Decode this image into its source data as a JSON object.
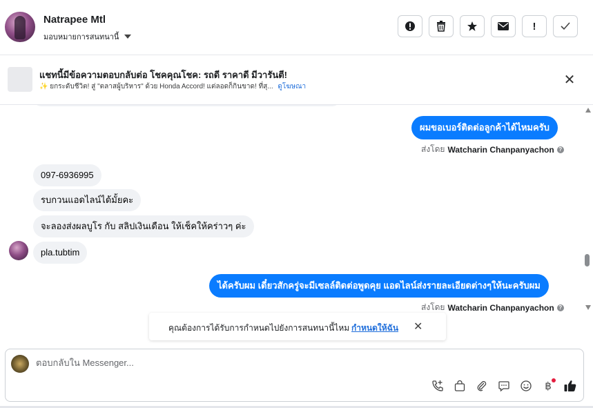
{
  "header": {
    "contact_name": "Natrapee Mtl",
    "assign_label": "มอบหมายการสนทนานี้",
    "actions": [
      {
        "name": "mark-spam-button",
        "icon": "alert-circle-icon"
      },
      {
        "name": "delete-button",
        "icon": "trash-icon"
      },
      {
        "name": "star-button",
        "icon": "star-icon"
      },
      {
        "name": "mark-unread-button",
        "icon": "envelope-icon"
      },
      {
        "name": "flag-button",
        "icon": "exclamation-icon"
      },
      {
        "name": "mark-done-button",
        "icon": "check-icon"
      }
    ]
  },
  "banner": {
    "title": "แชทนี้มีข้อความตอบกลับต่อ โชคคุณโชค: รถดี ราคาดี มีวารันตี!",
    "subtitle": "✨ ยกระดับชีวิต! สู่ \"ตลาสผู้บริหาร\" ด้วย Honda Accord! แต่ลอดก็กินขาด! ที่สุ...",
    "link": "ดูโฆษณา",
    "close_icon": "close-icon"
  },
  "messages": {
    "m1": "ผมขอเบอร์ติดต่อลูกค้าได้ไหมครับ",
    "sent_prefix": "ส่งโดย",
    "sender": "Watcharin Chanpanyachon",
    "m2": "097-6936995",
    "m3": "รบกวนแอดไลน์ได้มั้ยคะ",
    "m4": "จะลองส่งผลบูโร กับ สลิปเงินเดือน ให้เช็คให้คร่าวๆ ค่ะ",
    "m5": "pla.tubtim",
    "m6": "ได้ครับผม เดี๋ยวสักครู่จะมีเซลล์ติดต่อพูดคุย แอดไลน์ส่งรายละเอียดต่างๆให้นะครับผม"
  },
  "notice": {
    "text": "คุณต้องการได้รับการกำหนดไปยังการสนทนานี้ไหม",
    "link": "กำหนดให้ฉัน"
  },
  "composer": {
    "placeholder": "ตอบกลับใน Messenger...",
    "tools": [
      "phone-add-icon",
      "shopping-bag-icon",
      "paperclip-icon",
      "chat-bubble-icon",
      "emoji-icon",
      "baht-icon",
      "thumbs-up-icon"
    ]
  },
  "colors": {
    "outgoing_bubble": "#0a7cff",
    "incoming_bubble": "#f0f2f5",
    "link": "#216fdb",
    "notification_dot": "#e41e3f"
  }
}
